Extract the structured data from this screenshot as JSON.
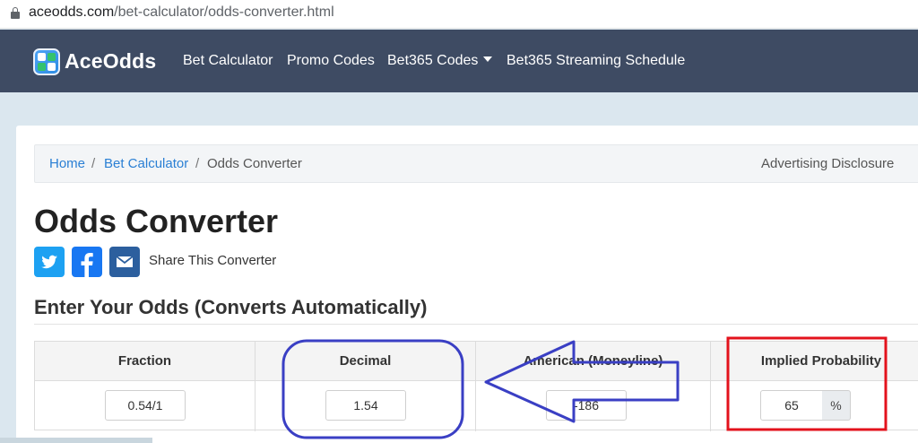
{
  "browser": {
    "url_host": "aceodds.com",
    "url_path": "/bet-calculator/odds-converter.html"
  },
  "navbar": {
    "logo": "AceOdds",
    "links": [
      {
        "label": "Bet Calculator"
      },
      {
        "label": "Promo Codes"
      },
      {
        "label": "Bet365 Codes"
      },
      {
        "label": "Bet365 Streaming Schedule"
      }
    ]
  },
  "breadcrumb": {
    "home": "Home",
    "sep": "/",
    "parent": "Bet Calculator",
    "current": "Odds Converter",
    "disclosure": "Advertising Disclosure"
  },
  "page": {
    "title": "Odds Converter",
    "share_label": "Share This Converter",
    "section_title": "Enter Your Odds (Converts Automatically)"
  },
  "converter": {
    "headers": {
      "fraction": "Fraction",
      "decimal": "Decimal",
      "american": "American (Moneyline)",
      "probability": "Implied Probability"
    },
    "values": {
      "fraction": "0.54/1",
      "decimal": "1.54",
      "american": "-186",
      "probability": "65",
      "percent_sign": "%"
    }
  },
  "annotations": {
    "ellipse_color": "#3a3fc4",
    "arrow_color": "#3a3fc4",
    "box_color": "#e3121c"
  },
  "colors": {
    "navbar": "#3e4b63",
    "link": "#2a7fd4"
  }
}
